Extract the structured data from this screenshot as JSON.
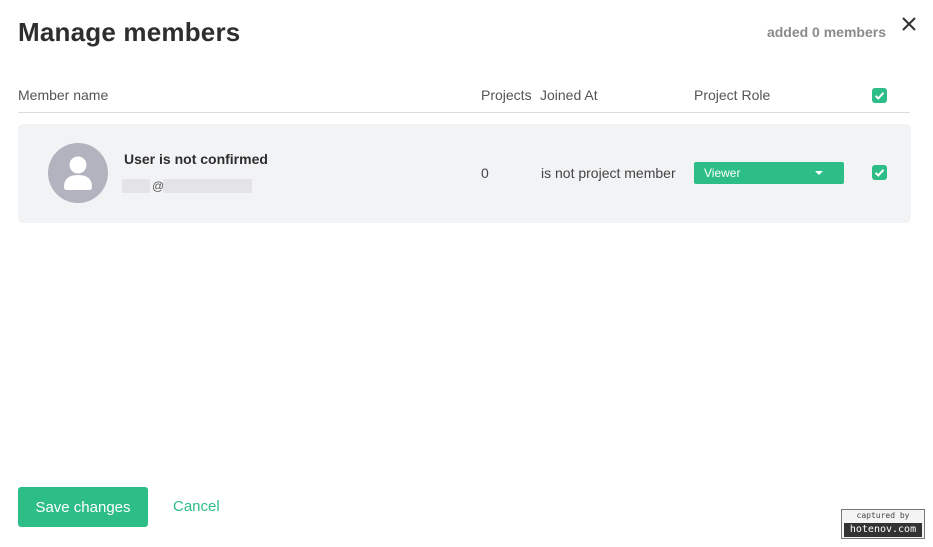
{
  "dialog": {
    "title": "Manage members",
    "added_text": "added 0 members"
  },
  "table": {
    "headers": {
      "member_name": "Member name",
      "projects": "Projects",
      "joined_at": "Joined At",
      "project_role": "Project Role"
    },
    "rows": [
      {
        "name": "User is not confirmed",
        "email_separator": "@",
        "projects": "0",
        "joined_at": "is not project member",
        "role": "Viewer",
        "selected": true
      }
    ]
  },
  "footer": {
    "save_label": "Save changes",
    "cancel_label": "Cancel"
  },
  "watermark": {
    "line1": "captured by",
    "line2": "hotenov.com"
  },
  "icons": {
    "close": "close-icon",
    "avatar": "user-avatar-icon",
    "dropdown": "caret-down-icon",
    "check": "check-icon"
  },
  "colors": {
    "accent": "#2dbd86",
    "row_background": "#f2f3f5",
    "avatar": "#b1b4be"
  }
}
